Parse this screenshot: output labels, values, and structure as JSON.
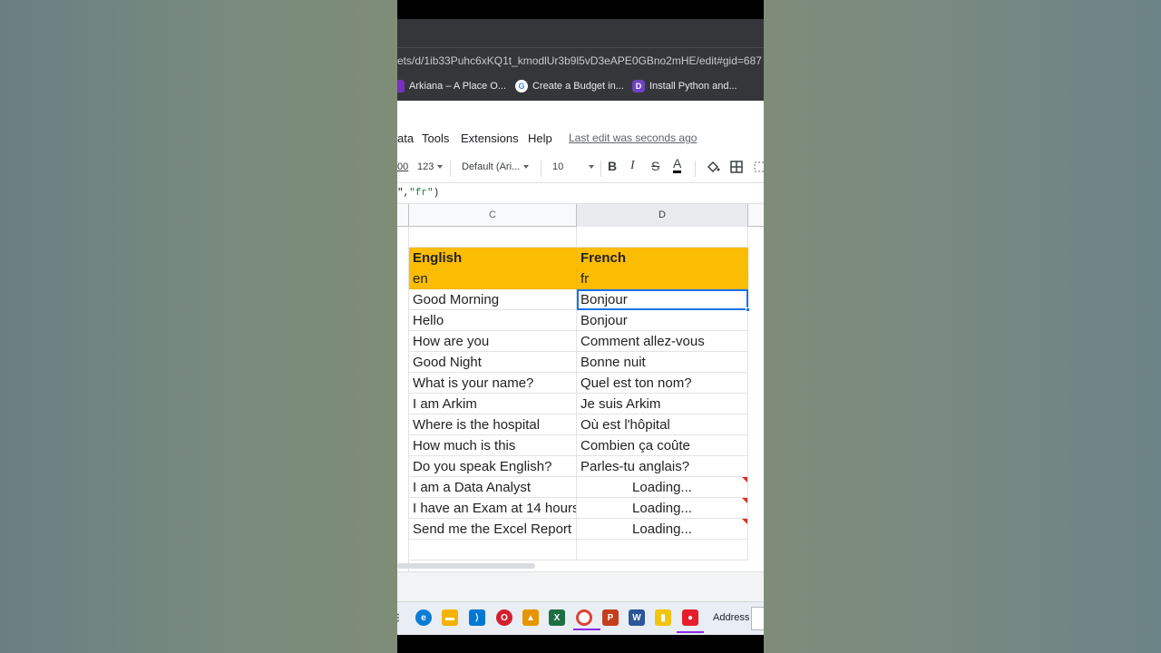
{
  "browser": {
    "url": "ets/d/1ib33Puhc6xKQ1t_kmodlUr3b9l5vD3eAPE0GBno2mHE/edit#gid=687",
    "bookmarks": [
      {
        "label": "Arkiana – A Place O...",
        "icon": "arkiana-icon",
        "color": "#7b2fbe"
      },
      {
        "label": "Create a Budget in...",
        "icon": "google-icon",
        "color": "#ffffff"
      },
      {
        "label": "Install Python and...",
        "icon": "python-site-icon",
        "color": "#6f42c1"
      }
    ]
  },
  "menu": {
    "items": [
      "ata",
      "Tools",
      "Extensions",
      "Help"
    ],
    "last_edit": "Last edit was seconds ago"
  },
  "toolbar": {
    "zoom_fragment": "00",
    "number_format": "123",
    "font": "Default (Ari...",
    "font_size": "10",
    "bold": "B",
    "italic": "I",
    "strike": "S",
    "text_color": "A"
  },
  "formula": {
    "prefix": "\",",
    "string": "\"fr\"",
    "suffix": ")"
  },
  "columns": [
    "C",
    "D"
  ],
  "sheet": {
    "header": {
      "c": "English",
      "d": "French"
    },
    "codes": {
      "c": "en",
      "d": "fr"
    },
    "rows": [
      {
        "c": "Good Morning",
        "d": "Bonjour"
      },
      {
        "c": "Hello",
        "d": "Bonjour"
      },
      {
        "c": "How are you",
        "d": "Comment allez-vous"
      },
      {
        "c": "Good Night",
        "d": "Bonne nuit"
      },
      {
        "c": "What is your name?",
        "d": "Quel est ton nom?"
      },
      {
        "c": "I am Arkim",
        "d": "Je suis Arkim"
      },
      {
        "c": "Where is the hospital",
        "d": "Où est l'hôpital"
      },
      {
        "c": "How much is this",
        "d": "Combien ça coûte"
      },
      {
        "c": "Do you speak English?",
        "d": "Parles-tu anglais?"
      },
      {
        "c": "I am a Data Analyst",
        "d": "Loading..."
      },
      {
        "c": "I have an Exam at 14 hours",
        "d": "Loading..."
      },
      {
        "c": "Send me the Excel Report",
        "d": "Loading..."
      }
    ]
  },
  "taskbar": {
    "address_label": "Address"
  },
  "colors": {
    "header_fill": "#fbbc04",
    "selection": "#1a73e8",
    "error_flag": "#d93025"
  }
}
